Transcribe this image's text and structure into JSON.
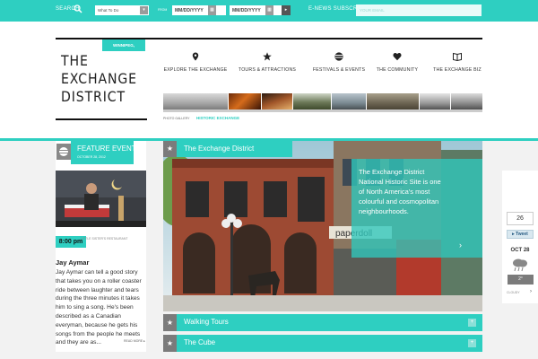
{
  "topbar": {
    "search_label": "SEARCH",
    "what_placeholder": "What To Do",
    "from_label": "FROM",
    "to_label": "TO",
    "from_date": "MM/DD/YYYY",
    "to_date": "MM/DD/YYYY",
    "news_label": "E-NEWS SUBSCRIPTION",
    "news_placeholder": "YOUR EMAIL",
    "accent": "#2ecfc1"
  },
  "header": {
    "location": "WINNIPEG, MANITOBA",
    "logo_line1": "THE",
    "logo_line2": "EXCHANGE",
    "logo_line3": "DISTRICT",
    "nav": [
      {
        "label": "EXPLORE THE EXCHANGE",
        "icon": "map-pin-icon"
      },
      {
        "label": "TOURS & ATTRACTIONS",
        "icon": "star-icon"
      },
      {
        "label": "FESTIVALS & EVENTS",
        "icon": "festival-icon"
      },
      {
        "label": "THE COMMUNITY",
        "icon": "heart-icon"
      },
      {
        "label": "THE EXCHANGE BIZ",
        "icon": "book-icon"
      }
    ],
    "strip_photo_label": "PHOTO GALLERY",
    "strip_active_label": "HISTORIC EXCHANGE"
  },
  "feature": {
    "heading": "FEATURE EVENT",
    "date": "OCTOBER 28, 2012",
    "time": "8:00 pm",
    "venue": "LITTLE SISTER'S RESTAURANT",
    "name": "Jay Aymar",
    "description": "Jay Aymar can tell a good story that takes you on a roller coaster ride between laughter and tears during the three minutes it takes him to sing a song. He's been described as a Canadian everyman, because he gets his songs from the people he meets and they are as...",
    "more": "READ MORE"
  },
  "hero": {
    "title": "The Exchange District",
    "text": "The Exchange District National Historic Site is one of North America's most colourful and cosmopolitan neighbourhoods.",
    "sign": "paperdoll"
  },
  "accordion": [
    {
      "label": "Walking Tours"
    },
    {
      "label": "The Cube"
    }
  ],
  "weather": {
    "count": "26",
    "tweet": "Tweet",
    "date": "OCT 28",
    "temp": "2°",
    "condition": "CLOUDY"
  }
}
